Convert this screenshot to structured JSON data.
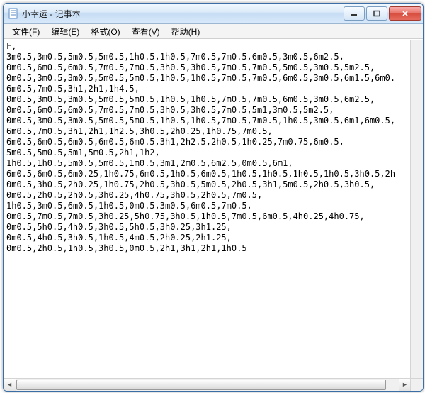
{
  "window": {
    "title": "小幸运 - 记事本"
  },
  "menu": {
    "file": "文件(F)",
    "edit": "编辑(E)",
    "format": "格式(O)",
    "view": "查看(V)",
    "help": "帮助(H)"
  },
  "content": "F,\n3m0.5,3m0.5,5m0.5,5m0.5,1h0.5,1h0.5,7m0.5,7m0.5,6m0.5,3m0.5,6m2.5,\n0m0.5,6m0.5,6m0.5,7m0.5,7m0.5,3h0.5,3h0.5,7m0.5,7m0.5,5m0.5,3m0.5,5m2.5,\n0m0.5,3m0.5,3m0.5,5m0.5,5m0.5,1h0.5,1h0.5,7m0.5,7m0.5,6m0.5,3m0.5,6m1.5,6m0.\n6m0.5,7m0.5,3h1,2h1,1h4.5,\n0m0.5,3m0.5,3m0.5,5m0.5,5m0.5,1h0.5,1h0.5,7m0.5,7m0.5,6m0.5,3m0.5,6m2.5,\n0m0.5,6m0.5,6m0.5,7m0.5,7m0.5,3h0.5,3h0.5,7m0.5,5m1,3m0.5,5m2.5,\n0m0.5,3m0.5,3m0.5,5m0.5,5m0.5,1h0.5,1h0.5,7m0.5,7m0.5,1h0.5,3m0.5,6m1,6m0.5,\n6m0.5,7m0.5,3h1,2h1,1h2.5,3h0.5,2h0.25,1h0.75,7m0.5,\n6m0.5,6m0.5,6m0.5,6m0.5,6m0.5,3h1,2h2.5,2h0.5,1h0.25,7m0.75,6m0.5,\n5m0.5,5m0.5,5m1,5m0.5,2h1,1h2,\n1h0.5,1h0.5,5m0.5,5m0.5,1m0.5,3m1,2m0.5,6m2.5,0m0.5,6m1,\n6m0.5,6m0.5,6m0.25,1h0.75,6m0.5,1h0.5,6m0.5,1h0.5,1h0.5,1h0.5,1h0.5,3h0.5,2h\n0m0.5,3h0.5,2h0.25,1h0.75,2h0.5,3h0.5,5m0.5,2h0.5,3h1,5m0.5,2h0.5,3h0.5,\n0m0.5,2h0.5,2h0.5,3h0.25,4h0.75,3h0.5,2h0.5,7m0.5,\n1h0.5,3m0.5,6m0.5,1h0.5,0m0.5,3m0.5,6m0.5,7m0.5,\n0m0.5,7m0.5,7m0.5,3h0.25,5h0.75,3h0.5,1h0.5,7m0.5,6m0.5,4h0.25,4h0.75,\n0m0.5,5h0.5,4h0.5,3h0.5,5h0.5,3h0.25,3h1.25,\n0m0.5,4h0.5,3h0.5,1h0.5,4m0.5,2h0.25,2h1.25,\n0m0.5,2h0.5,1h0.5,3h0.5,0m0.5,2h1,3h1,2h1,1h0.5"
}
